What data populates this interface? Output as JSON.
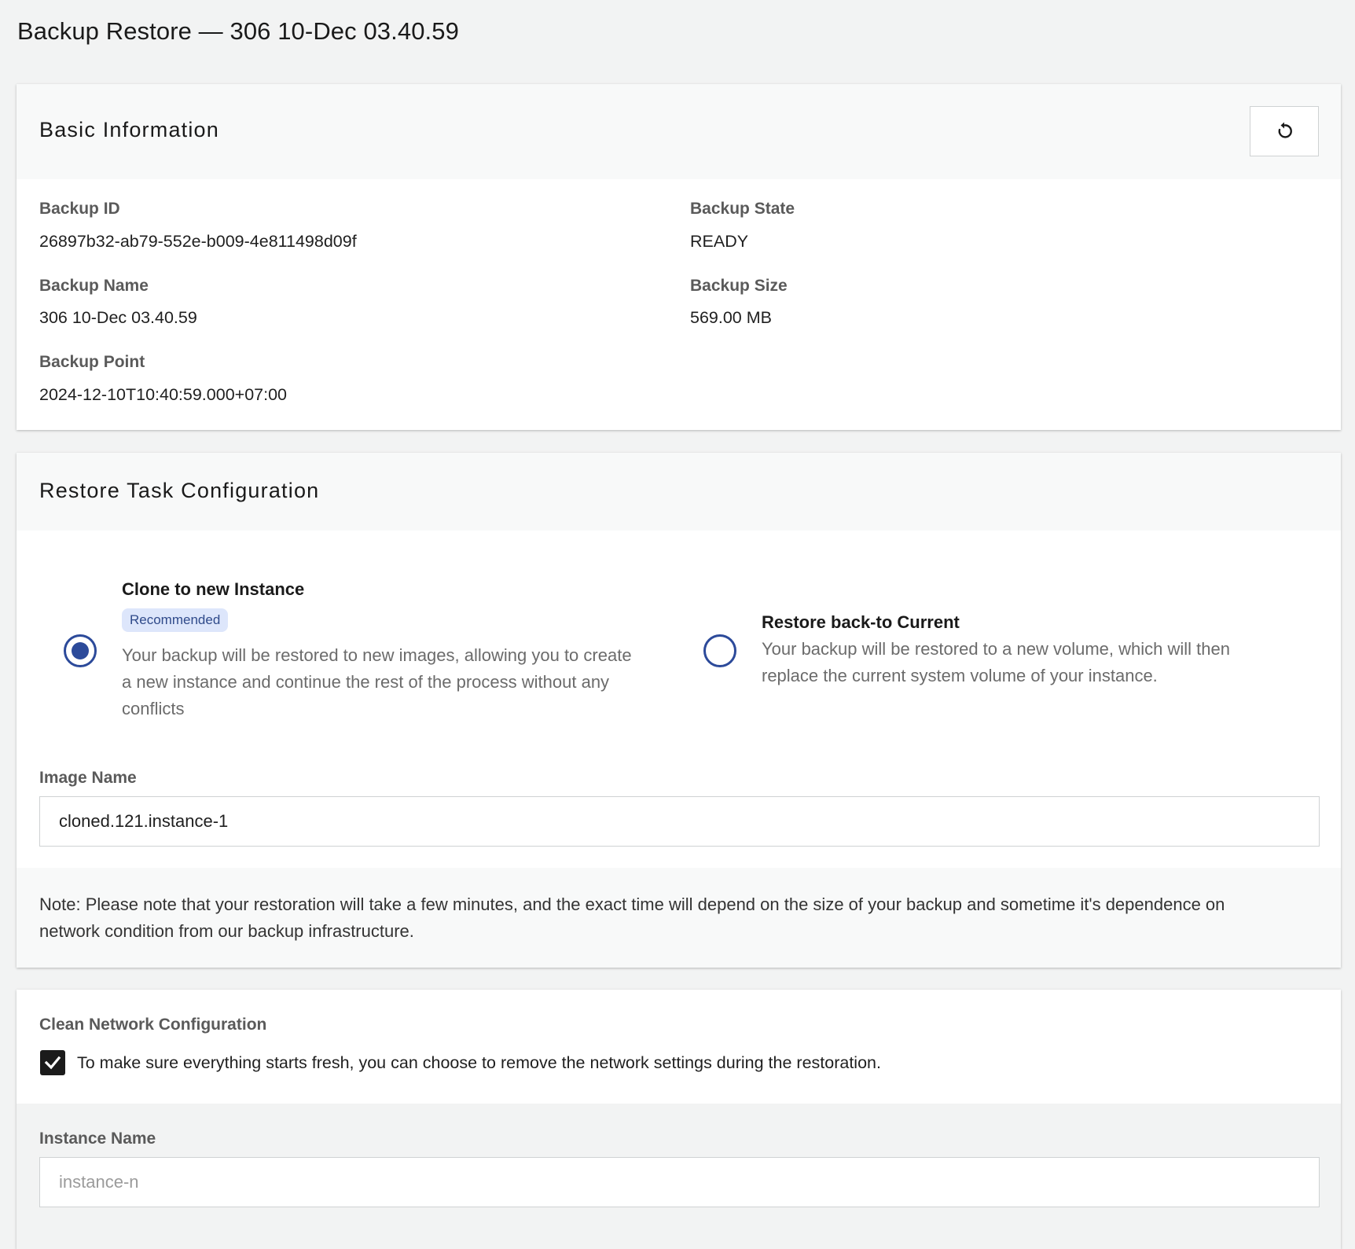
{
  "page": {
    "title": "Backup Restore — 306 10-Dec 03.40.59"
  },
  "basic_info": {
    "title": "Basic Information",
    "refresh_icon": "refresh-icon",
    "fields": {
      "backup_id": {
        "label": "Backup ID",
        "value": "26897b32-ab79-552e-b009-4e811498d09f"
      },
      "backup_state": {
        "label": "Backup State",
        "value": "READY"
      },
      "backup_name": {
        "label": "Backup Name",
        "value": "306 10-Dec 03.40.59"
      },
      "backup_size": {
        "label": "Backup Size",
        "value": "569.00 MB"
      },
      "backup_point": {
        "label": "Backup Point",
        "value": "2024-12-10T10:40:59.000+07:00"
      }
    }
  },
  "restore_config": {
    "title": "Restore Task Configuration",
    "options": {
      "clone": {
        "title": "Clone to new Instance",
        "badge": "Recommended",
        "desc_line1": "Your backup will be restored to new images, allowing you to create",
        "desc_line2": "a new instance and continue the rest of the process without any",
        "desc_line3": "conflicts",
        "selected": true
      },
      "restore_current": {
        "title": "Restore back-to Current",
        "desc_line1": "Your backup will be restored to a new volume, which will then",
        "desc_line2": "replace the current system volume of your instance.",
        "selected": false
      }
    },
    "image_name": {
      "label": "Image Name",
      "value": "cloned.121.instance-1"
    },
    "note_line1": "Note: Please note that your restoration will take a few minutes, and the exact time will depend on the size of your backup and sometime it's dependence on",
    "note_line2": "network condition from our backup infrastructure."
  },
  "network": {
    "label": "Clean Network Configuration",
    "checkbox_text": "To make sure everything starts fresh, you can choose to remove the network settings during the restoration.",
    "checked": true
  },
  "instance": {
    "label": "Instance Name",
    "placeholder": "instance-n",
    "value": ""
  },
  "colors": {
    "accent": "#2c4a9a",
    "badge_bg": "#dde6fb",
    "page_bg": "#f2f3f3"
  }
}
